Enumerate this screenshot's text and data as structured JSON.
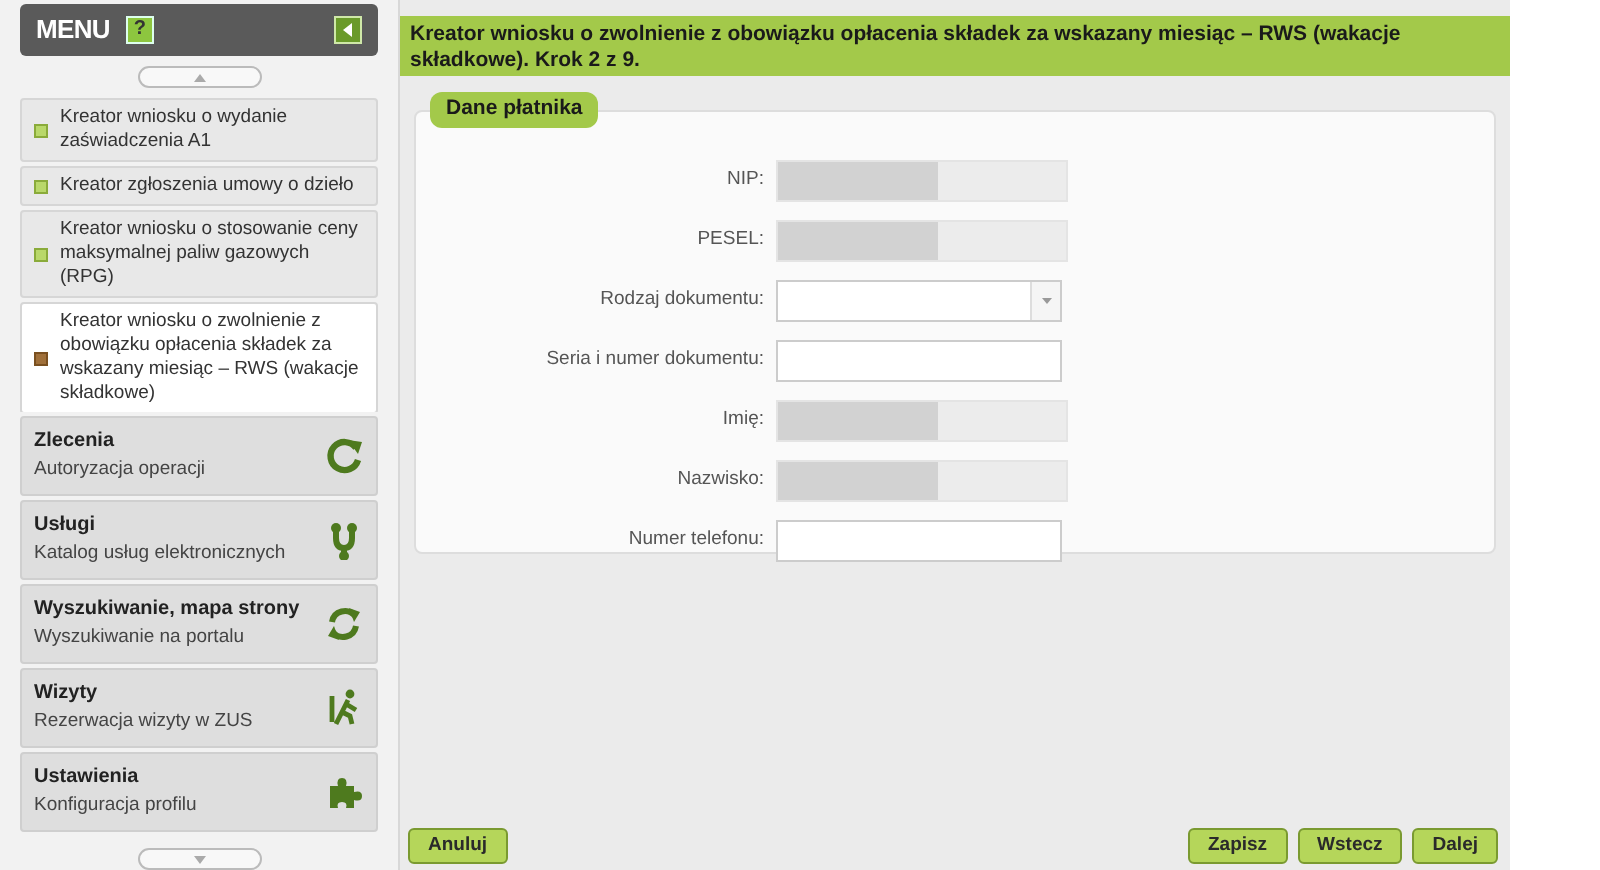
{
  "menu": {
    "title": "MENU",
    "help_icon": "?",
    "subitems": [
      {
        "label": "Kreator wniosku o wydanie zaświadczenia A1",
        "selected": false
      },
      {
        "label": "Kreator zgłoszenia umowy o dzieło",
        "selected": false
      },
      {
        "label": "Kreator wniosku o stosowanie ceny maksymalnej paliw gazowych (RPG)",
        "selected": false
      },
      {
        "label": "Kreator wniosku o zwolnienie z obowiązku opłacenia składek za wskazany miesiąc – RWS (wakacje składkowe)",
        "selected": true
      }
    ],
    "sections": [
      {
        "title": "Zlecenia",
        "subtitle": "Autoryzacja operacji"
      },
      {
        "title": "Usługi",
        "subtitle": "Katalog usług elektronicznych"
      },
      {
        "title": "Wyszukiwanie, mapa strony",
        "subtitle": "Wyszukiwanie na portalu"
      },
      {
        "title": "Wizyty",
        "subtitle": "Rezerwacja wizyty w ZUS"
      },
      {
        "title": "Ustawienia",
        "subtitle": "Konfiguracja profilu"
      }
    ]
  },
  "header": "Kreator wniosku o zwolnienie z obowiązku opłacenia składek za wskazany miesiąc – RWS (wakacje składkowe). Krok 2 z 9.",
  "fieldset": {
    "legend": "Dane płatnika",
    "fields": [
      {
        "label": "NIP:",
        "kind": "masked"
      },
      {
        "label": "PESEL:",
        "kind": "masked"
      },
      {
        "label": "Rodzaj dokumentu:",
        "kind": "select"
      },
      {
        "label": "Seria i numer dokumentu:",
        "kind": "text"
      },
      {
        "label": "Imię:",
        "kind": "masked"
      },
      {
        "label": "Nazwisko:",
        "kind": "masked"
      },
      {
        "label": "Numer telefonu:",
        "kind": "text"
      }
    ]
  },
  "buttons_left": [
    "Anuluj"
  ],
  "buttons_right": [
    "Zapisz",
    "Wstecz",
    "Dalej"
  ]
}
